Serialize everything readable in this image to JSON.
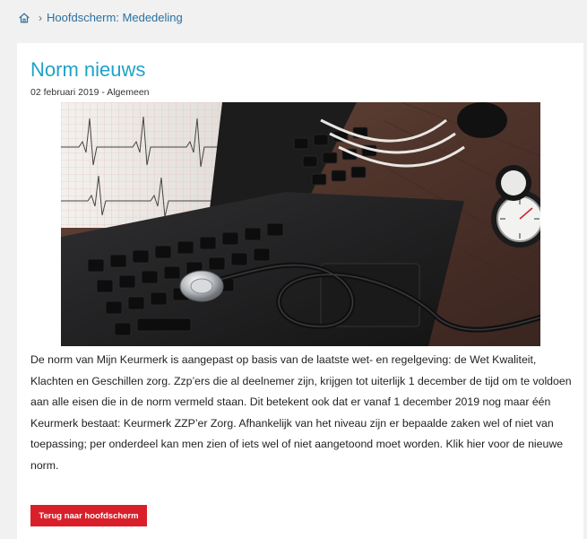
{
  "breadcrumb": {
    "home_icon": "home-icon",
    "separator": "›",
    "current": "Hoofdscherm: Mededeling"
  },
  "article": {
    "title": "Norm nieuws",
    "meta": "02 februari 2019 - Algemeen",
    "image_subject": "laptop-with-stethoscope",
    "body": "De norm van Mijn Keurmerk is aangepast op basis van de laatste wet- en regelgeving: de Wet Kwaliteit, Klachten en Geschillen zorg. Zzp’ers die al deelnemer zijn, krijgen tot uiterlijk 1 december de tijd om te voldoen aan alle eisen die in de norm vermeld staan. Dit betekent ook dat er vanaf 1 december 2019 nog maar één Keurmerk bestaat: Keurmerk ZZP’er Zorg. Afhankelijk van het niveau zijn er bepaalde zaken wel of niet van toepassing; per onderdeel kan men zien of iets wel of niet aangetoond moet worden. Klik hier voor de nieuwe norm.",
    "back_button": "Terug naar hoofdscherm"
  },
  "colors": {
    "accent": "#1ea3c9",
    "link": "#2a6fa0",
    "button": "#d9202a",
    "background": "#f1f1f1"
  }
}
